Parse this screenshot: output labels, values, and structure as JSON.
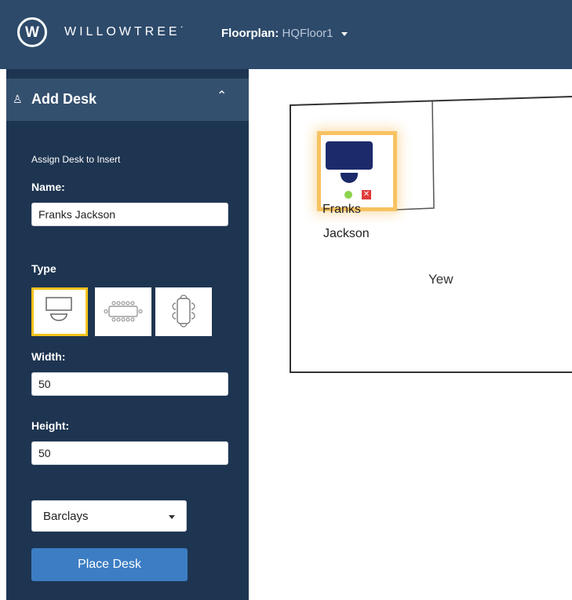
{
  "header": {
    "brand": "WILLOWTREE˙",
    "logo_letter": "W",
    "floorplan_label": "Floorplan:",
    "floorplan_value": "HQFloor1"
  },
  "sidebar": {
    "title": "Add Desk",
    "assign_label": "Assign Desk to Insert",
    "name_label": "Name:",
    "name_value": "Franks Jackson",
    "type_label": "Type",
    "type_options": [
      "desk-icon",
      "conference-table-icon",
      "round-table-icon"
    ],
    "selected_type": 0,
    "width_label": "Width:",
    "width_value": "50",
    "height_label": "Height:",
    "height_value": "50",
    "company_value": "Barclays",
    "place_button": "Place Desk"
  },
  "floor": {
    "desk_name_line1": "Franks",
    "desk_name_line2": "Jackson",
    "room_name": "Yew"
  },
  "colors": {
    "header_bg": "#2d4a6b",
    "sidebar_bg": "#1e3551",
    "accent_blue": "#3c7dc4",
    "selection_yellow": "#f3c21b",
    "desk_navy": "#1c2a6b",
    "status_green": "#8bd34c",
    "delete_red": "#e03b3b"
  }
}
